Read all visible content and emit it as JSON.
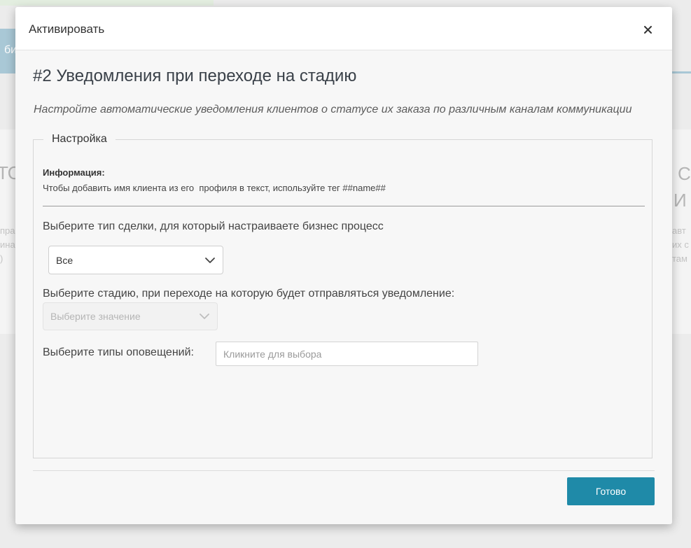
{
  "background": {
    "blue_tab_text": "би",
    "left_big_text": "ТО",
    "left_small_lines": [
      "пра",
      "ина",
      ")"
    ],
    "right_big_lines": [
      "С",
      "И"
    ],
    "right_small_lines": [
      "авт",
      "их с",
      "там"
    ]
  },
  "modal": {
    "title": "Активировать",
    "close_symbol": "×",
    "heading": "#2 Уведомления при переходе на стадию",
    "subtitle": "Настройте автоматические уведомления клиентов о статусе их заказа по различным каналам коммуникации",
    "fieldset": {
      "legend": "Настройка",
      "info_title": "Информация:",
      "info_text": "Чтобы добавить имя клиента из его  профиля в текст, используйте тег ##name##"
    },
    "deal_type": {
      "label": "Выберите тип сделки, для который настраиваете бизнес процесс",
      "selected": "Все"
    },
    "stage": {
      "label": "Выберите стадию, при переходе на которую будет отправляться уведомление:",
      "placeholder": "Выберите значение"
    },
    "notification_types": {
      "label": "Выберите типы оповещений:",
      "placeholder": "Кликните для выбора"
    },
    "done_label": "Готово"
  },
  "colors": {
    "accent": "#1f8aa8",
    "background_blue": "#a9c8d6"
  },
  "icons": {
    "close": "close-icon",
    "dropdown": "chevron-down-icon"
  }
}
